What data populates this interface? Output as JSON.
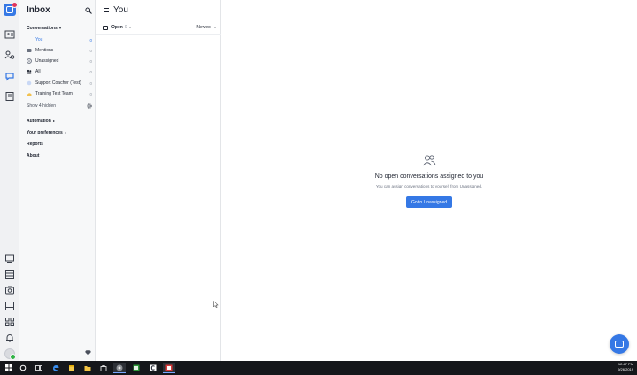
{
  "rail": {
    "icons": [
      "app-logo-icon",
      "contacts-icon",
      "people-settings-icon",
      "inbox-chat-icon",
      "knowledge-book-icon",
      "new-message-icon",
      "reports-icon",
      "outbound-icon",
      "articles-icon",
      "apps-icon",
      "notifications-icon"
    ]
  },
  "nav": {
    "title": "Inbox",
    "conversations_label": "Conversations",
    "items": [
      {
        "label": "You",
        "count": "0",
        "icon": "user-icon",
        "active": true
      },
      {
        "label": "Mentions",
        "count": "0",
        "icon": "mention-icon"
      },
      {
        "label": "Unassigned",
        "count": "0",
        "icon": "unassigned-icon"
      },
      {
        "label": "All",
        "count": "0",
        "icon": "team-icon"
      },
      {
        "label": "Support Coacher (Test)",
        "count": "0",
        "icon": "bot-icon"
      },
      {
        "label": "Training Test Team",
        "count": "0",
        "icon": "hand-icon"
      }
    ],
    "show_hidden": "Show 4 hidden",
    "automation": "Automation",
    "preferences": "Your preferences",
    "reports": "Reports",
    "about": "About"
  },
  "list": {
    "title": "You",
    "open_label": "Open",
    "open_count": "0",
    "sort_label": "Newest"
  },
  "main": {
    "empty_title": "No open conversations assigned to you",
    "empty_subtitle": "You can assign conversations to yourself from Unassigned.",
    "button_label": "Go to Unassigned"
  },
  "taskbar": {
    "time": "12:47 PM",
    "date": "9/26/2019",
    "colors": {
      "accent": "#3578e5",
      "taskbar": "#15171b"
    }
  }
}
